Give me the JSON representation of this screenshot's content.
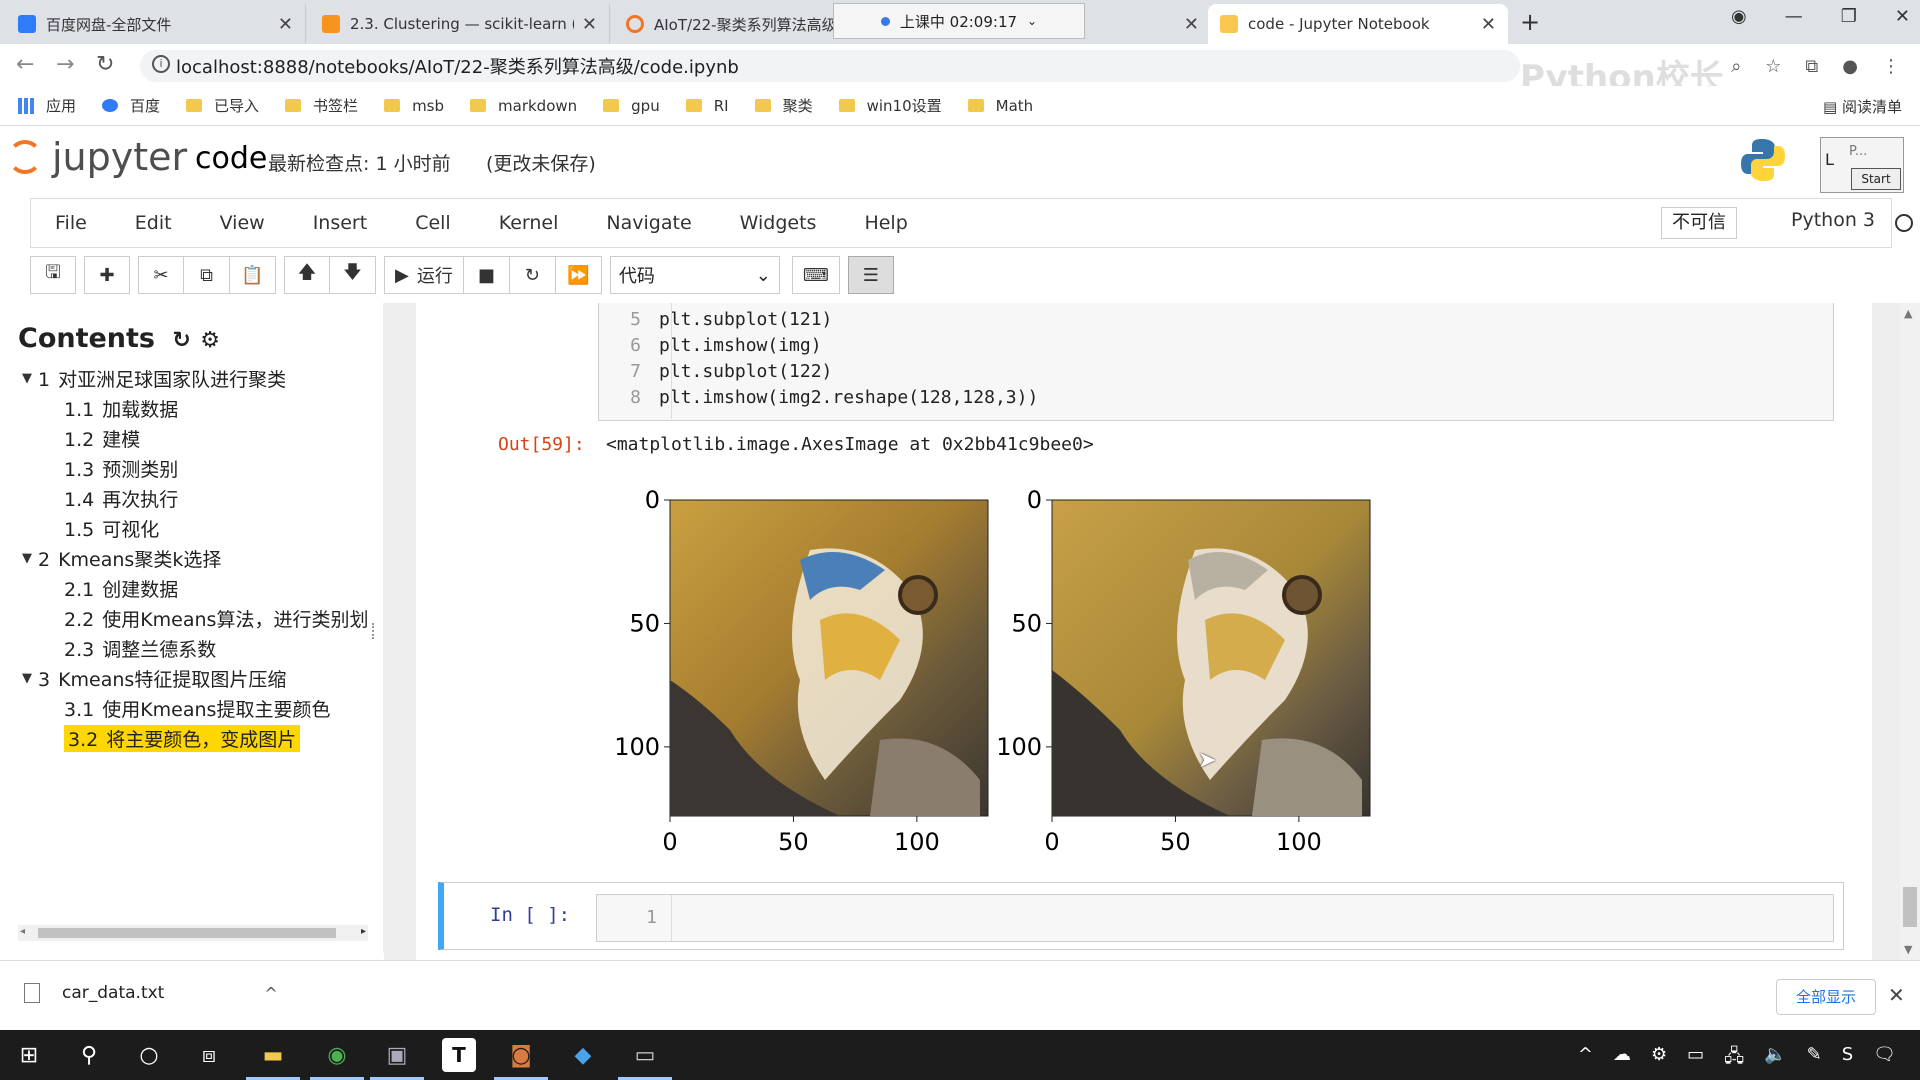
{
  "browser": {
    "tabs": [
      {
        "title": "百度网盘-全部文件",
        "favicon_color": "#2f7cf6"
      },
      {
        "title": "2.3. Clustering — scikit-learn (",
        "favicon_color": "#f7931e"
      },
      {
        "title": "AIoT/22-聚类系列算法高级",
        "favicon_color": "#f37626"
      },
      {
        "title": "code - Jupyter Notebook",
        "favicon_color": "#f37626"
      }
    ],
    "recording": "上课中 02:09:17",
    "url": "localhost:8888/notebooks/AIoT/22-聚类系列算法高级/code.ipynb",
    "watermark": "Python校长",
    "bookmarks": [
      "应用",
      "百度",
      "已导入",
      "书签栏",
      "msb",
      "markdown",
      "gpu",
      "RI",
      "聚类",
      "win10设置",
      "Math"
    ],
    "reading_list": "阅读清单"
  },
  "jupyter": {
    "logo_text": "jupyter",
    "notebook_name": "code",
    "checkpoint": "最新检查点: 1 小时前",
    "unsaved": "(更改未保存)",
    "start_box_label": "P...",
    "start_button": "Start",
    "menus": [
      "File",
      "Edit",
      "View",
      "Insert",
      "Cell",
      "Kernel",
      "Navigate",
      "Widgets",
      "Help"
    ],
    "trusted": "不可信",
    "kernel": "Python 3",
    "toolbar": {
      "run_label": "运行",
      "cell_type": "代码"
    }
  },
  "toc": {
    "title": "Contents",
    "items": [
      {
        "num": "1",
        "label": "对亚洲足球国家队进行聚类",
        "level": 1
      },
      {
        "num": "1.1",
        "label": "加载数据",
        "level": 2
      },
      {
        "num": "1.2",
        "label": "建模",
        "level": 2
      },
      {
        "num": "1.3",
        "label": "预测类别",
        "level": 2
      },
      {
        "num": "1.4",
        "label": "再次执行",
        "level": 2
      },
      {
        "num": "1.5",
        "label": "可视化",
        "level": 2
      },
      {
        "num": "2",
        "label": "Kmeans聚类k选择",
        "level": 1
      },
      {
        "num": "2.1",
        "label": "创建数据",
        "level": 2
      },
      {
        "num": "2.2",
        "label": "使用Kmeans算法，进行类别划",
        "level": 2
      },
      {
        "num": "2.3",
        "label": "调整兰德系数",
        "level": 2
      },
      {
        "num": "3",
        "label": "Kmeans特征提取图片压缩",
        "level": 1
      },
      {
        "num": "3.1",
        "label": "使用Kmeans提取主要颜色",
        "level": 2
      },
      {
        "num": "3.2",
        "label": "将主要颜色，变成图片",
        "level": 2,
        "active": true
      }
    ]
  },
  "cell": {
    "code_lines": [
      {
        "n": "5",
        "code": "plt.subplot(121)"
      },
      {
        "n": "6",
        "code": "plt.imshow(img)"
      },
      {
        "n": "7",
        "code": "plt.subplot(122)"
      },
      {
        "n": "8",
        "code": "plt.imshow(img2.reshape(128,128,3))"
      }
    ],
    "out_prompt": "Out[59]:",
    "out_text": "<matplotlib.image.AxesImage at 0x2bb41c9bee0>",
    "plots": [
      {
        "yticks": [
          "0",
          "50",
          "100"
        ],
        "xticks": [
          "0",
          "50",
          "100"
        ]
      },
      {
        "yticks": [
          "0",
          "50",
          "100"
        ],
        "xticks": [
          "0",
          "50",
          "100"
        ]
      }
    ]
  },
  "new_cell": {
    "prompt": "In  [  ]:",
    "line": "1"
  },
  "downloads": {
    "file": "car_data.txt",
    "show_all": "全部显示"
  }
}
